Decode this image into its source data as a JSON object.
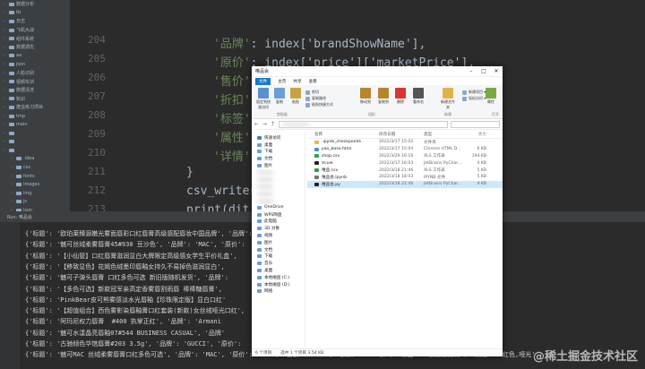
{
  "project_tree": [
    "数据分析",
    "tb",
    "日志",
    "飞机大战",
    "组件系统",
    "数据调优",
    "aa",
    "json",
    "人脸识别",
    "视频实训",
    "数据清洗",
    "知识",
    "爬虫练习项目",
    "tmp",
    "main",
    "",
    "",
    "",
    ".idea",
    "css",
    "fonts",
    "images",
    "img",
    "js",
    "json",
    "csv",
    "index.html"
  ],
  "toolbar_tabs": [
    "",
    "文件夹选项"
  ],
  "editor": {
    "line_numbers": [
      "204",
      "205",
      "206",
      "207",
      "208",
      "209",
      "210",
      "211",
      "212",
      "213"
    ],
    "lines": [
      {
        "key": "'品牌'",
        "rest": ": index['brandShowName'],"
      },
      {
        "key": "'原价'",
        "rest": ": index['price']['marketPrice'],"
      },
      {
        "key": "'售价'",
        "rest": ""
      },
      {
        "key": "'折扣'",
        "rest": ""
      },
      {
        "key": "'标签'",
        "rest": ""
      },
      {
        "key": "'属性'",
        "rest": ""
      },
      {
        "key": "'详情'",
        "rest": ""
      },
      {
        "key": "}",
        "rest": ""
      },
      {
        "key": "csv_writer",
        "rest": ""
      },
      {
        "key": "print(dit)",
        "rest": ""
      }
    ]
  },
  "run_panel": {
    "header": "Run: 唯品会",
    "lines": [
      "{'标题': '欧珀莱臻源嫩光雾面唇彩口红唇膏高级感配唇妆中国品牌', '品牌': '",
      "{'标题': '魅可丝绒柔雾唇膏45#930 豆沙色', '品牌': 'MAC', '原价': ",
      "{'标题': '【小仙管】口红唇膏滋润显白大牌限定高级感女学生平价礼盒', ",
      "{'标题': '【移致显色】花嫣色绒墨印唇釉女持久不易掉色滋润显白', ",
      "{'标题': '魅可子弹头唇膏 口红多色可选 新旧版随机发货', '品牌':",
      "{'标题': '【多色可选】新款冠军亲高定香雾唇割雨唇 棒棒糖唇膏',",
      "{'标题': 'PinkBear皮可熊雾感淡水光唇釉【珍珠限定版】显白口红'",
      "{'标题': '【超值组合】西色雾影染唇釉膏口红套装(新款)女丝绒哑光口红',",
      "{'标题': '阿玛尼权力唇膏  #400 执掌正红', '品牌': 'Armani",
      "{'标题': '魅可水漾晶亮唇釉07#544 BUSINESS CASUAL', '品牌'",
      "{'标题': '古驰倾色华馆唇膏#203 3.5g', '品牌': 'GUCCI', '原价':",
      "{'标题': '魅可MAC 丝绒柔雾唇膏口红多色可选', '品牌': 'MAC', '原价': '160', '售价': '148', '折扣': '8.1折', '标签': '限量版抢购', '属性': '红色,哑光'"
    ]
  },
  "explorer": {
    "title": "唯品会",
    "tabs": [
      "文件",
      "主页",
      "共享",
      "查看"
    ],
    "ribbon": {
      "buttons": [
        {
          "label": "固定到快速访问"
        },
        {
          "label": "复制"
        },
        {
          "label": "粘贴"
        },
        {
          "label": "移动到"
        },
        {
          "label": "复制到"
        },
        {
          "label": "删除"
        },
        {
          "label": "重命名"
        },
        {
          "label": "新建文件夹"
        },
        {
          "label": "属性"
        }
      ],
      "small": [
        "剪切",
        "复制路径",
        "粘贴快捷方式",
        "新建项目 ▾",
        "轻松访问 ▾",
        "打开 ▾",
        "编辑",
        "历史记录",
        "全部选择",
        "全部取消",
        "反向选择"
      ],
      "groups": [
        "剪贴板",
        "组织",
        "新建",
        "打开",
        "选择"
      ]
    },
    "address": {
      "path": "",
      "search": ""
    },
    "nav_items": [
      "快速访问",
      "桌面",
      "下载",
      "文档",
      "图片",
      "",
      "",
      "",
      "",
      "",
      "OneDrive",
      "WPS网盘",
      "此电脑",
      "3D 对象",
      "视频",
      "图片",
      "文档",
      "下载",
      "音乐",
      "桌面",
      "本地磁盘 (C:)",
      "本地磁盘 (D:)",
      "网络"
    ],
    "columns": [
      "名称",
      "修改日期",
      "类型",
      "大小"
    ],
    "files": [
      {
        "name": ".ipynb_checkpoints",
        "date": "2022/3/17 15:02",
        "type": "文件夹",
        "size": "",
        "sel": false,
        "color": "#e8b84a"
      },
      {
        "name": "jiao_base.html",
        "date": "2022/3/17 15:04",
        "type": "Chrome HTML D...",
        "size": "6 KB",
        "sel": false,
        "color": "#4a90d9"
      },
      {
        "name": "shop.csv",
        "date": "2022/3/29 16:16",
        "type": "XLS 工作表",
        "size": "194 KB",
        "sel": false,
        "color": "#2e9e4f"
      },
      {
        "name": "Vcule",
        "date": "2022/3/17 16:03",
        "type": "JetBrains PyChar...",
        "size": "4 KB",
        "sel": false,
        "color": "#222"
      },
      {
        "name": "唯品.csv",
        "date": "2022/3/18 21:46",
        "type": "XLS 工作表",
        "size": "5 KB",
        "sel": false,
        "color": "#2e9e4f"
      },
      {
        "name": "唯品会.ipynb",
        "date": "2022/3/18 18:03",
        "type": "IPYNB 文件",
        "size": "5 KB",
        "sel": false,
        "color": "#777"
      },
      {
        "name": "唯品会.py",
        "date": "2022/3/18 21:46",
        "type": "JetBrains PyChar...",
        "size": "4 KB",
        "sel": true,
        "color": "#222"
      }
    ],
    "status": [
      "6 个项目",
      "选中 1 个项目 3.54 KB"
    ]
  },
  "watermark": "@稀土掘金技术社区"
}
